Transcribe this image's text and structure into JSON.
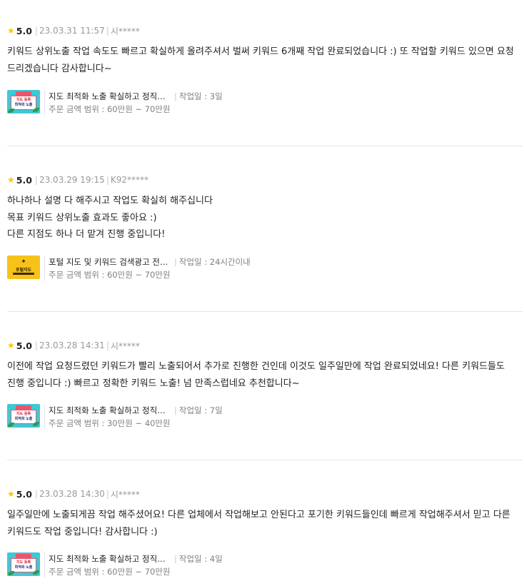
{
  "rating_icon": "star-icon",
  "star_color": "#ffc400",
  "divider_color": "#e4e5ed",
  "reviews": [
    {
      "rating": "5.0",
      "date": "23.03.31 11:57",
      "user": "시*****",
      "lines": [
        "키워드 상위노출 작업 속도도 빠르고 확실하게 올려주셔서 벌써 키워드 6개째 작업 완료되었습니다 :) 또 작업할 키워드 있으면 요청",
        "드리겠습니다 감사합니다~"
      ],
      "gig": {
        "thumbnail": "map-exposure-thumbnail",
        "thumb_text_1": "지도 등록",
        "thumb_text_2": "최적화 노출",
        "title": "지도 최적화 노출 확실하고 정직하게 해드립니다",
        "days": "작업일 : 3일",
        "price": "주문 금액 범위 : 60만원 ~ 70만원"
      }
    },
    {
      "rating": "5.0",
      "date": "23.03.29 19:15",
      "user": "K92*****",
      "lines": [
        "하나하나 설명 다 해주시고 작업도 확실히 해주십니다",
        "목표 키워드 상위노출 효과도 좋아요 :)",
        "다른 지점도 하나 더 맡겨 진행 중입니다!"
      ],
      "gig": {
        "thumbnail": "portal-map-thumbnail",
        "thumb_text_1": "포털지도",
        "thumb_text_2": "",
        "title": "포털 지도 및 키워드 검색광고 전문 대행",
        "days": "작업일 : 24시간이내",
        "price": "주문 금액 범위 : 60만원 ~ 70만원"
      }
    },
    {
      "rating": "5.0",
      "date": "23.03.28 14:31",
      "user": "시*****",
      "lines": [
        "이전에 작업 요청드렸던 키워드가 빨리 노출되어서 추가로 진행한 건인데 이것도 일주일만에 작업 완료되었네요! 다른 키워드들도",
        "진행 중입니다 :) 빠르고 정확한 키워드 노출! 넘 만족스럽네요 추천합니다~"
      ],
      "gig": {
        "thumbnail": "map-exposure-thumbnail",
        "thumb_text_1": "지도 등록",
        "thumb_text_2": "최적화 노출",
        "title": "지도 최적화 노출 확실하고 정직하게 해드립니다",
        "days": "작업일 : 7일",
        "price": "주문 금액 범위 : 30만원 ~ 40만원"
      }
    },
    {
      "rating": "5.0",
      "date": "23.03.28 14:30",
      "user": "시*****",
      "lines": [
        "일주일만에 노출되게끔 작업 해주셨어요! 다른 업체에서 작업해보고 안된다고 포기한 키워드들인데 빠르게 작업해주셔서 믿고 다른",
        "키워드도 작업 중입니다! 감사합니다 :)"
      ],
      "gig": {
        "thumbnail": "map-exposure-thumbnail",
        "thumb_text_1": "지도 등록",
        "thumb_text_2": "최적화 노출",
        "title": "지도 최적화 노출 확실하고 정직하게 해드립니다",
        "days": "작업일 : 4일",
        "price": "주문 금액 범위 : 60만원 ~ 70만원"
      }
    }
  ]
}
